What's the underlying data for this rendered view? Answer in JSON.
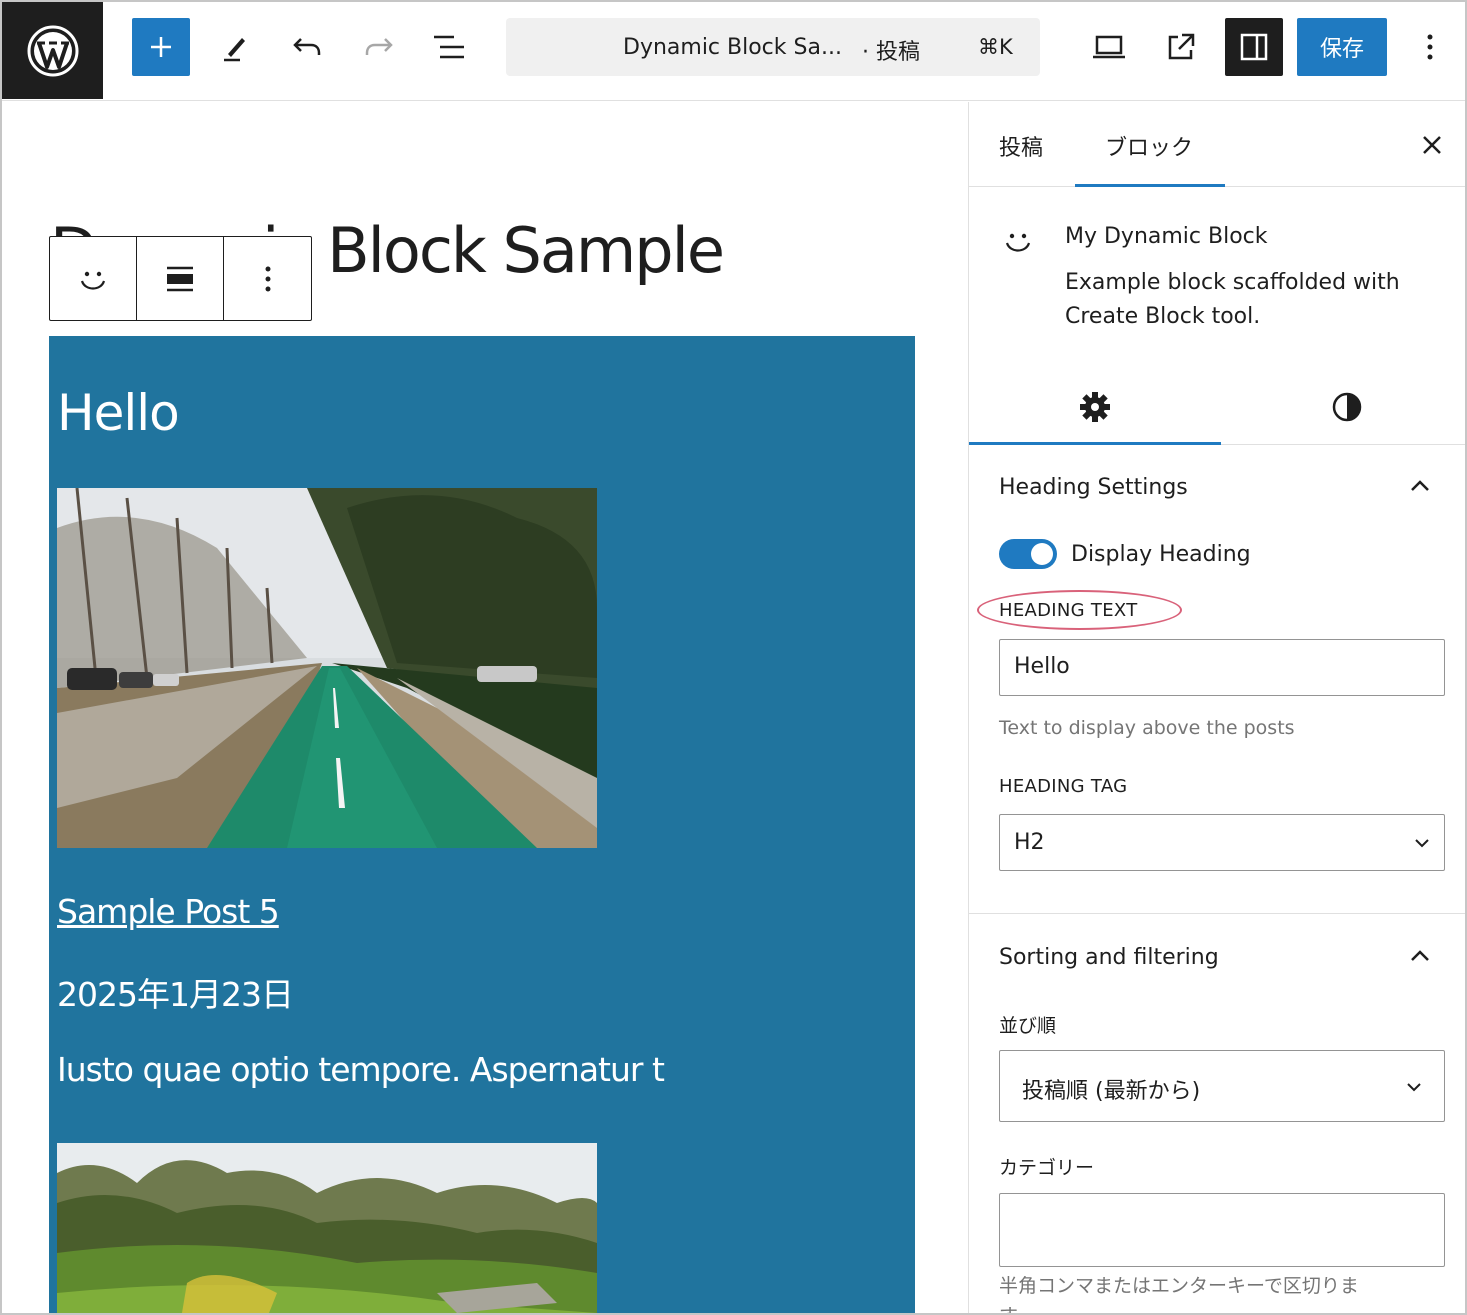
{
  "topbar": {
    "doc_title": "Dynamic Block Sa...",
    "doc_type": "· 投稿",
    "shortcut": "⌘K",
    "save_label": "保存",
    "icons": [
      "wordpress-logo",
      "plus-icon",
      "pen-icon",
      "undo-icon",
      "redo-icon",
      "list-view-icon",
      "desktop-preview-icon",
      "external-link-icon",
      "sidebar-icon",
      "more-vertical-icon"
    ]
  },
  "editor": {
    "post_title": "Dynamic Block Sample",
    "block_toolbar": {
      "icons": [
        "smiley-icon",
        "align-icon",
        "more-vertical-icon"
      ]
    },
    "block": {
      "heading": "Hello",
      "post_link": "Sample Post 5",
      "post_date": "2025年1月23日",
      "excerpt": "Iusto quae optio tempore. Aspernatur t",
      "background": "#20749e"
    }
  },
  "sidebar": {
    "tabs": [
      "投稿",
      "ブロック"
    ],
    "active_tab": "ブロック",
    "block_card": {
      "name": "My Dynamic Block",
      "description": "Example block scaffolded with Create Block tool."
    },
    "inspector_tabs": [
      "settings-gear-icon",
      "styles-contrast-icon"
    ],
    "heading_settings": {
      "title": "Heading Settings",
      "toggle_label": "Display Heading",
      "toggle_on": true,
      "heading_text_label": "HEADING TEXT",
      "heading_text_value": "Hello",
      "heading_text_help": "Text to display above the posts",
      "heading_tag_label": "HEADING TAG",
      "heading_tag_value": "H2"
    },
    "sorting": {
      "title": "Sorting and filtering",
      "order_label": "並び順",
      "order_value": "投稿順 (最新から)",
      "category_label": "カテゴリー",
      "category_value": "",
      "category_help": "半角コンマまたはエンターキーで区切りま",
      "category_help_2": "す"
    }
  },
  "colors": {
    "accent": "#1f7ac1",
    "block_bg": "#20749e",
    "annotation": "#d9627a"
  }
}
